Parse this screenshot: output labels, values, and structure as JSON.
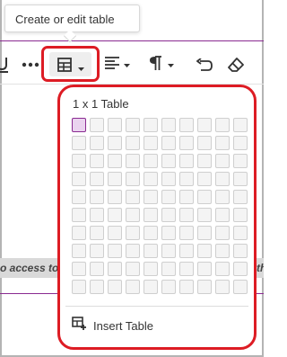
{
  "tooltip": {
    "text": "Create or edit table"
  },
  "toolbar": {
    "items": [
      {
        "icon": "underline-icon"
      },
      {
        "icon": "more-options-icon"
      },
      {
        "icon": "table-icon"
      },
      {
        "icon": "align-icon"
      },
      {
        "icon": "paragraph-icon"
      },
      {
        "icon": "undo-icon"
      },
      {
        "icon": "clear-format-icon"
      }
    ]
  },
  "content": {
    "left_fragment": "o access to",
    "right_fragment": "th"
  },
  "table_picker": {
    "size_label": "1 x 1 Table",
    "rows": 10,
    "cols": 10,
    "selected_rows": 1,
    "selected_cols": 1,
    "insert_label": "Insert Table"
  },
  "colors": {
    "highlight_red": "#dd1c24",
    "accent_purple": "#8a2a91"
  }
}
